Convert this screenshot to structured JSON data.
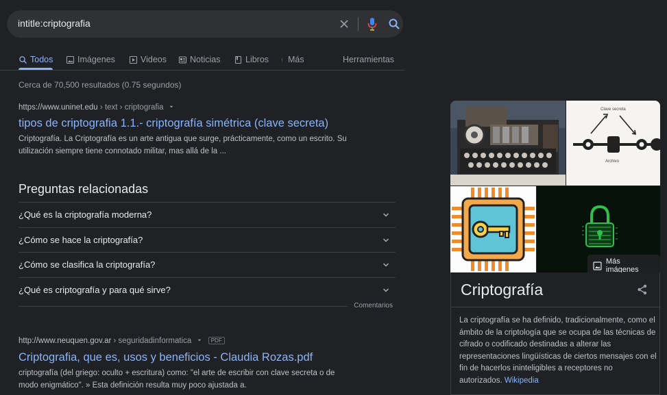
{
  "search": {
    "query": "intitle:criptografia"
  },
  "tabs": [
    {
      "label": "Todos",
      "icon": "search-icon"
    },
    {
      "label": "Imágenes",
      "icon": "image-icon"
    },
    {
      "label": "Videos",
      "icon": "video-icon"
    },
    {
      "label": "Noticias",
      "icon": "news-icon"
    },
    {
      "label": "Libros",
      "icon": "book-icon"
    },
    {
      "label": "Más",
      "icon": "more-vert-icon"
    }
  ],
  "tools_label": "Herramientas",
  "stats": "Cerca de 70,500 resultados (0.75 segundos)",
  "result1": {
    "domain": "https://www.uninet.edu",
    "path": " › text › criptografia",
    "title": "tipos de criptografia 1.1.- criptografía simétrica (clave secreta)",
    "snippet_line1": "Criptografía. La Criptografía es un arte antigua que surge, prácticamente, como un escrito. Su",
    "snippet_line2": "utilización siempre tiene connotado militar, mas allá de la ..."
  },
  "paa": {
    "title": "Preguntas relacionadas",
    "questions": [
      "¿Qué es la criptografía moderna?",
      "¿Cómo se hace la criptografía?",
      "¿Cómo se clasifica la criptografía?",
      "¿Qué es criptografía y para qué sirve?"
    ],
    "feedback": "Comentarios"
  },
  "result2": {
    "domain": "http://www.neuquen.gov.ar",
    "path": " › seguridadinformatica",
    "badge": "PDF",
    "title": "Criptografia, que es, usos y beneficios - Claudia Rozas.pdf",
    "snippet_line1": "criptografía (del griego: oculto + escritura) como: \"el arte de escribir con clave secreta o de",
    "snippet_line2": "modo enigmático\". » Esta definición resulta muy poco ajustada a."
  },
  "knowledge_panel": {
    "more_images": "Más imágenes",
    "diagram_label_top": "Clave secreta",
    "diagram_label_mid": "Archivo",
    "title": "Criptografía",
    "description": "La criptografía se ha definido, tradicionalmente, como el ámbito de la criptología que se ocupa de las técnicas de cifrado o codificado destinadas a alterar las representaciones lingüísticas de ciertos mensajes con el fin de hacerlos ininteligibles a receptores no autorizados.",
    "source": "Wikipedia"
  },
  "colors": {
    "background": "#202124",
    "link": "#8ab4f8",
    "text": "#bdc1c6",
    "accent": "#8ab4f8"
  }
}
